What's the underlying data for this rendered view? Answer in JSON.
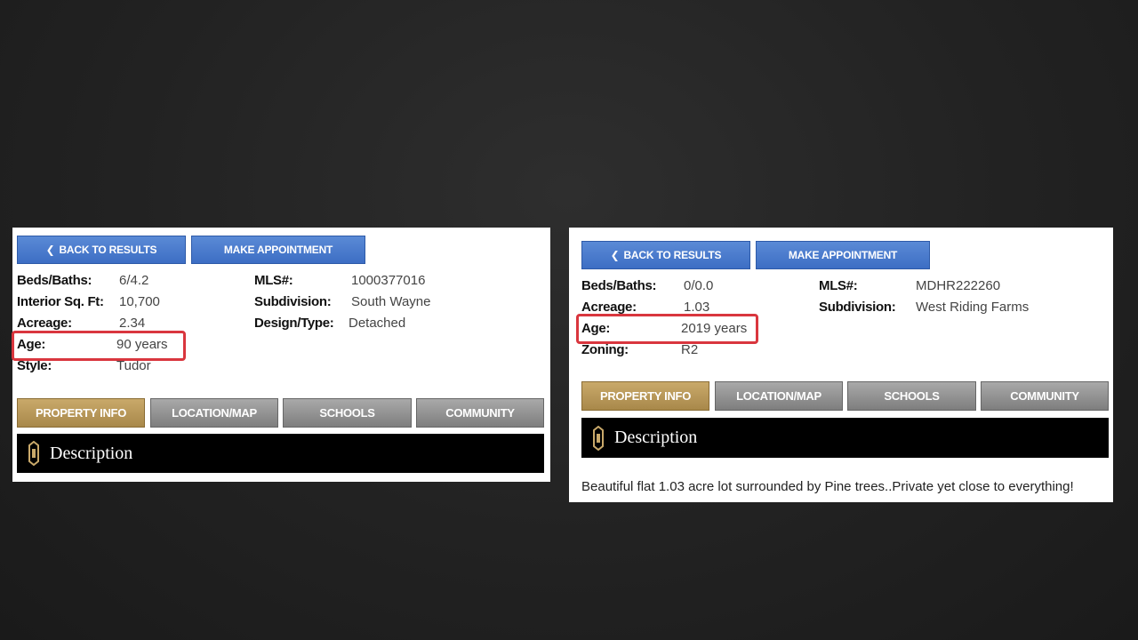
{
  "left": {
    "buttons": {
      "back": "BACK TO RESULTS",
      "appointment": "MAKE APPOINTMENT"
    },
    "details_left": [
      {
        "label": "Beds/Baths:",
        "value": "6/4.2"
      },
      {
        "label": "Interior Sq. Ft:",
        "value": "10,700"
      },
      {
        "label": "Acreage:",
        "value": "2.34"
      },
      {
        "label": "Age:",
        "value": "90 years"
      },
      {
        "label": "Style:",
        "value": "Tudor"
      }
    ],
    "details_right": [
      {
        "label": "MLS#:",
        "value": "1000377016"
      },
      {
        "label": "Subdivision:",
        "value": "South Wayne"
      },
      {
        "label": "Design/Type:",
        "value": "Detached"
      }
    ],
    "tabs": [
      "PROPERTY INFO",
      "LOCATION/MAP",
      "SCHOOLS",
      "COMMUNITY"
    ],
    "description_title": "Description"
  },
  "right": {
    "buttons": {
      "back": "BACK TO RESULTS",
      "appointment": "MAKE APPOINTMENT"
    },
    "details_left": [
      {
        "label": "Beds/Baths:",
        "value": "0/0.0"
      },
      {
        "label": "Acreage:",
        "value": "1.03"
      },
      {
        "label": "Age:",
        "value": "2019 years"
      },
      {
        "label": "Zoning:",
        "value": "R2"
      }
    ],
    "details_right": [
      {
        "label": "MLS#:",
        "value": "MDHR222260"
      },
      {
        "label": "Subdivision:",
        "value": "West Riding Farms"
      }
    ],
    "tabs": [
      "PROPERTY INFO",
      "LOCATION/MAP",
      "SCHOOLS",
      "COMMUNITY"
    ],
    "description_title": "Description",
    "description_text": "Beautiful flat 1.03 acre lot surrounded by Pine trees..Private yet close to everything!"
  },
  "colors": {
    "button_blue": "#3d6ec4",
    "tab_gold": "#a8884a",
    "tab_gray": "#7e7e7e",
    "highlight_red": "#d9363e"
  }
}
